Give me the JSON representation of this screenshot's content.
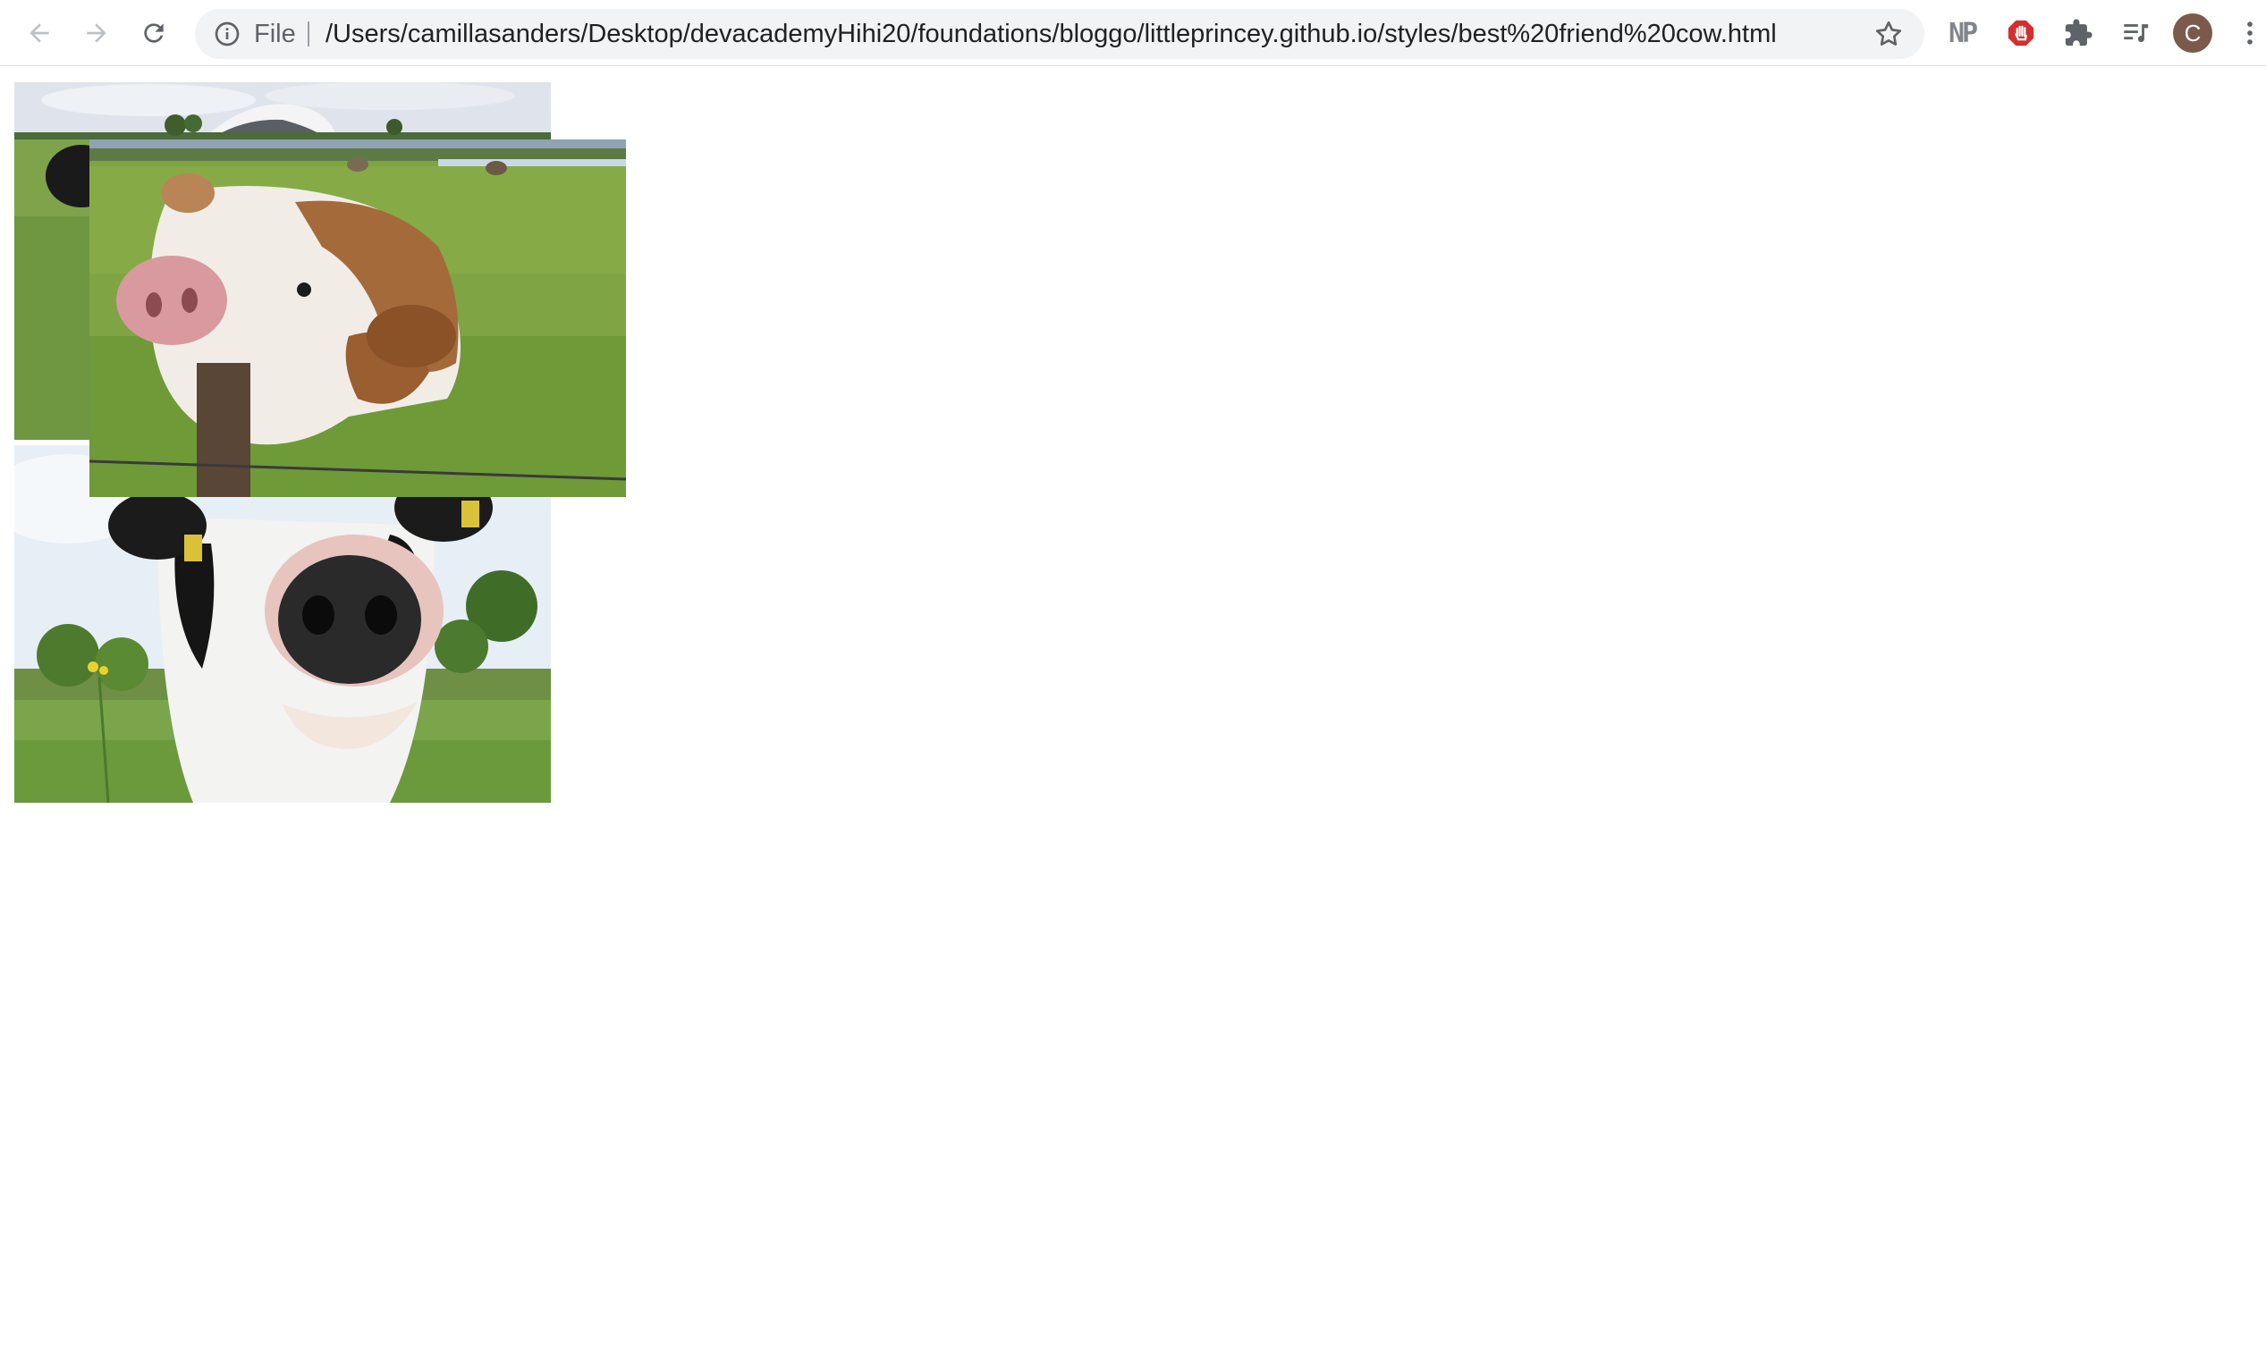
{
  "browser": {
    "address_bar": {
      "scheme_label": "File",
      "url": "/Users/camillasanders/Desktop/devacademyHihi20/foundations/bloggo/littleprincey.github.io/styles/best%20friend%20cow.html"
    },
    "nav_buttons": [
      "back-icon",
      "forward-icon",
      "reload-icon"
    ],
    "extensions": {
      "np_label": "NP",
      "items": [
        "np-extension-icon",
        "adblock-icon",
        "puzzle-icon",
        "media-control-icon"
      ]
    },
    "profile": {
      "initial": "C",
      "color": "#7b5a4c"
    }
  },
  "page": {
    "images": [
      {
        "name": "cow-photo-1",
        "subject": "black cow in field under cloudy sky"
      },
      {
        "name": "cow-photo-2",
        "subject": "brown and white cow leaning on fence post"
      },
      {
        "name": "cow-photo-3",
        "subject": "black and white cow close-up of nose"
      }
    ]
  }
}
